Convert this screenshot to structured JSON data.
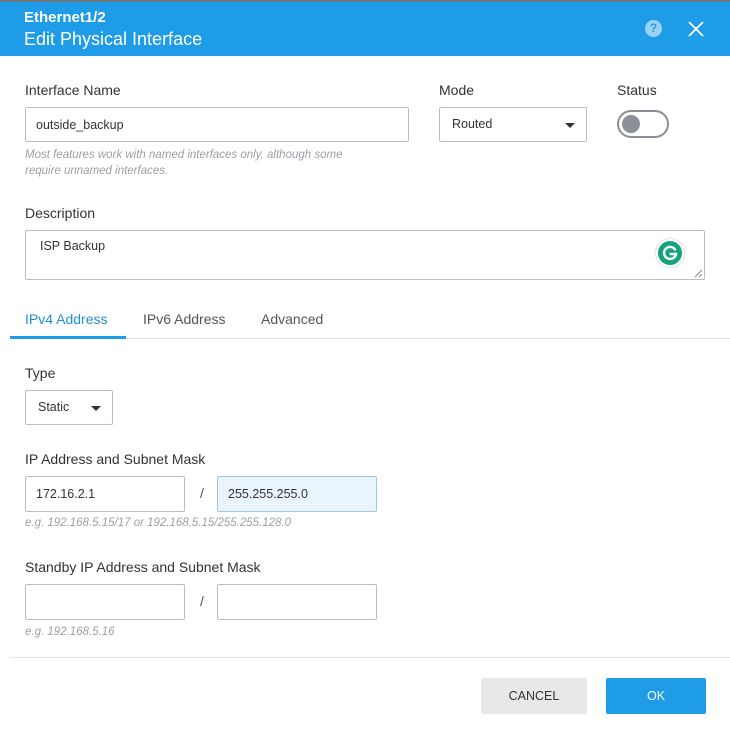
{
  "header": {
    "subtitle": "Ethernet1/2",
    "title": "Edit Physical Interface",
    "help_icon": "question-circle-icon",
    "close_icon": "close-icon",
    "help_glyph": "?"
  },
  "interface_name": {
    "label": "Interface Name",
    "value": "outside_backup",
    "hint_line1": "Most features work with named interfaces only, although some",
    "hint_line2": "require unnamed interfaces."
  },
  "mode": {
    "label": "Mode",
    "selected": "Routed"
  },
  "status": {
    "label": "Status",
    "enabled": false
  },
  "description": {
    "label": "Description",
    "value": "ISP Backup"
  },
  "tabs": [
    {
      "label": "IPv4 Address",
      "active": true
    },
    {
      "label": "IPv6 Address",
      "active": false
    },
    {
      "label": "Advanced",
      "active": false
    }
  ],
  "ipv4": {
    "type_label": "Type",
    "type_selected": "Static",
    "ip_label": "IP Address and Subnet Mask",
    "ip_value": "172.16.2.1",
    "mask_value": "255.255.255.0",
    "separator": "/",
    "ip_hint": "e.g. 192.168.5.15/17 or 192.168.5.15/255.255.128.0",
    "standby_label": "Standby IP Address and Subnet Mask",
    "standby_ip_value": "",
    "standby_mask_value": "",
    "standby_hint": "e.g. 192.168.5.16"
  },
  "footer": {
    "cancel_label": "CANCEL",
    "ok_label": "OK"
  },
  "colors": {
    "accent": "#1f9ce8",
    "grammarly": "#15a37f"
  }
}
